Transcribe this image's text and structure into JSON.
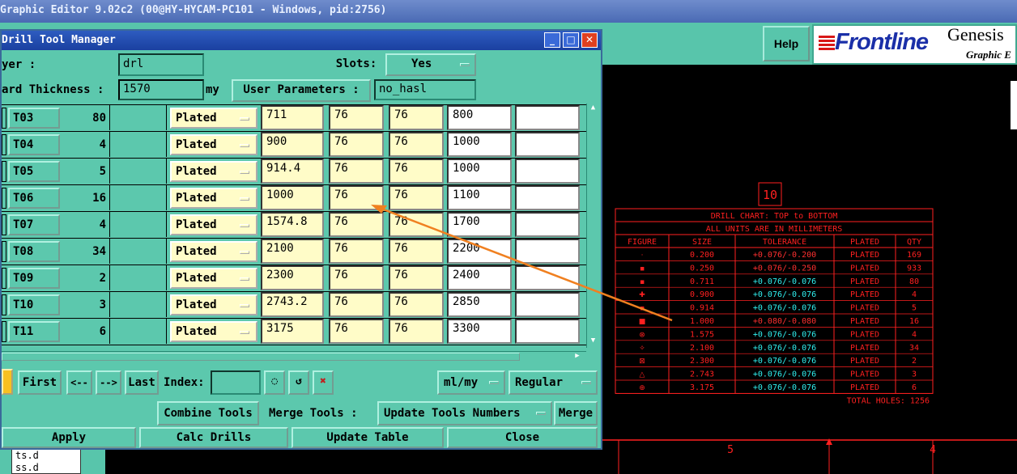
{
  "app_title": "Graphic Editor 9.02c2 (00@HY-HYCAM-PC101 - Windows, pid:2756)",
  "header": {
    "help_label": "Help",
    "logo_text": "Frontline",
    "logo_genesis": "Genesis",
    "logo_subtitle": "Graphic E"
  },
  "left_list": [
    "ts.d",
    "ss.d"
  ],
  "dialog": {
    "title": "Drill Tool Manager",
    "layer_label": "yer                :",
    "layer_value": "drl",
    "slots_label": "Slots:",
    "slots_value": "Yes",
    "thickness_label": "ard Thickness :",
    "thickness_value": "1570",
    "thickness_unit": "my",
    "user_params_label": "User Parameters :",
    "user_params_value": "no_hasl",
    "tools": [
      {
        "name": "T03",
        "count": "80",
        "type": "Plated",
        "finish": "711",
        "plus": "76",
        "minus": "76",
        "drill": "800",
        "note": ""
      },
      {
        "name": "T04",
        "count": "4",
        "type": "Plated",
        "finish": "900",
        "plus": "76",
        "minus": "76",
        "drill": "1000",
        "note": ""
      },
      {
        "name": "T05",
        "count": "5",
        "type": "Plated",
        "finish": "914.4",
        "plus": "76",
        "minus": "76",
        "drill": "1000",
        "note": ""
      },
      {
        "name": "T06",
        "count": "16",
        "type": "Plated",
        "finish": "1000",
        "plus": "76",
        "minus": "76",
        "drill": "1100",
        "note": ""
      },
      {
        "name": "T07",
        "count": "4",
        "type": "Plated",
        "finish": "1574.8",
        "plus": "76",
        "minus": "76",
        "drill": "1700",
        "note": ""
      },
      {
        "name": "T08",
        "count": "34",
        "type": "Plated",
        "finish": "2100",
        "plus": "76",
        "minus": "76",
        "drill": "2200",
        "note": ""
      },
      {
        "name": "T09",
        "count": "2",
        "type": "Plated",
        "finish": "2300",
        "plus": "76",
        "minus": "76",
        "drill": "2400",
        "note": ""
      },
      {
        "name": "T10",
        "count": "3",
        "type": "Plated",
        "finish": "2743.2",
        "plus": "76",
        "minus": "76",
        "drill": "2850",
        "note": ""
      },
      {
        "name": "T11",
        "count": "6",
        "type": "Plated",
        "finish": "3175",
        "plus": "76",
        "minus": "76",
        "drill": "3300",
        "note": ""
      }
    ],
    "nav": {
      "first": "First",
      "prev": "<--",
      "next": "-->",
      "last": "Last",
      "index_label": "Index:",
      "index_value": "",
      "units": "ml/my",
      "mode": "Regular"
    },
    "combine_tools": "Combine Tools",
    "merge_tools_label": "Merge Tools :",
    "update_tools_numbers": "Update Tools Numbers",
    "merge": "Merge",
    "apply": "Apply",
    "calc_drills": "Calc Drills",
    "update_table": "Update Table",
    "close": "Close"
  },
  "drill_chart": {
    "layer_number": "10",
    "title": "DRILL CHART: TOP to BOTTOM",
    "subtitle": "ALL UNITS ARE IN MILLIMETERS",
    "headers": [
      "FIGURE",
      "SIZE",
      "TOLERANCE",
      "PLATED",
      "QTY"
    ],
    "rows": [
      {
        "size": "0.200",
        "tol": "+0.076/-0.200",
        "plated": "PLATED",
        "qty": "169",
        "tol_color": "#ff3030"
      },
      {
        "size": "0.250",
        "tol": "+0.076/-0.250",
        "plated": "PLATED",
        "qty": "933",
        "tol_color": "#ff3030"
      },
      {
        "size": "0.711",
        "tol": "+0.076/-0.076",
        "plated": "PLATED",
        "qty": "80",
        "tol_color": "#30f0f0"
      },
      {
        "size": "0.900",
        "tol": "+0.076/-0.076",
        "plated": "PLATED",
        "qty": "4",
        "tol_color": "#30f0f0"
      },
      {
        "size": "0.914",
        "tol": "+0.076/-0.076",
        "plated": "PLATED",
        "qty": "5",
        "tol_color": "#30f0f0"
      },
      {
        "size": "1.000",
        "tol": "+0.080/-0.080",
        "plated": "PLATED",
        "qty": "16",
        "tol_color": "#ff3030"
      },
      {
        "size": "1.575",
        "tol": "+0.076/-0.076",
        "plated": "PLATED",
        "qty": "4",
        "tol_color": "#30f0f0"
      },
      {
        "size": "2.100",
        "tol": "+0.076/-0.076",
        "plated": "PLATED",
        "qty": "34",
        "tol_color": "#30f0f0"
      },
      {
        "size": "2.300",
        "tol": "+0.076/-0.076",
        "plated": "PLATED",
        "qty": "2",
        "tol_color": "#30f0f0"
      },
      {
        "size": "2.743",
        "tol": "+0.076/-0.076",
        "plated": "PLATED",
        "qty": "3",
        "tol_color": "#30f0f0"
      },
      {
        "size": "3.175",
        "tol": "+0.076/-0.076",
        "plated": "PLATED",
        "qty": "6",
        "tol_color": "#30f0f0"
      }
    ],
    "total": "TOTAL HOLES:  1256",
    "ruler_labels": [
      "5",
      "4"
    ]
  },
  "colors": {
    "panel": "#5cc8ad",
    "cell_yellow": "#fffcc8",
    "chart_red": "#ff2020",
    "chart_cyan": "#30f0f0",
    "arrow": "#f08020"
  }
}
